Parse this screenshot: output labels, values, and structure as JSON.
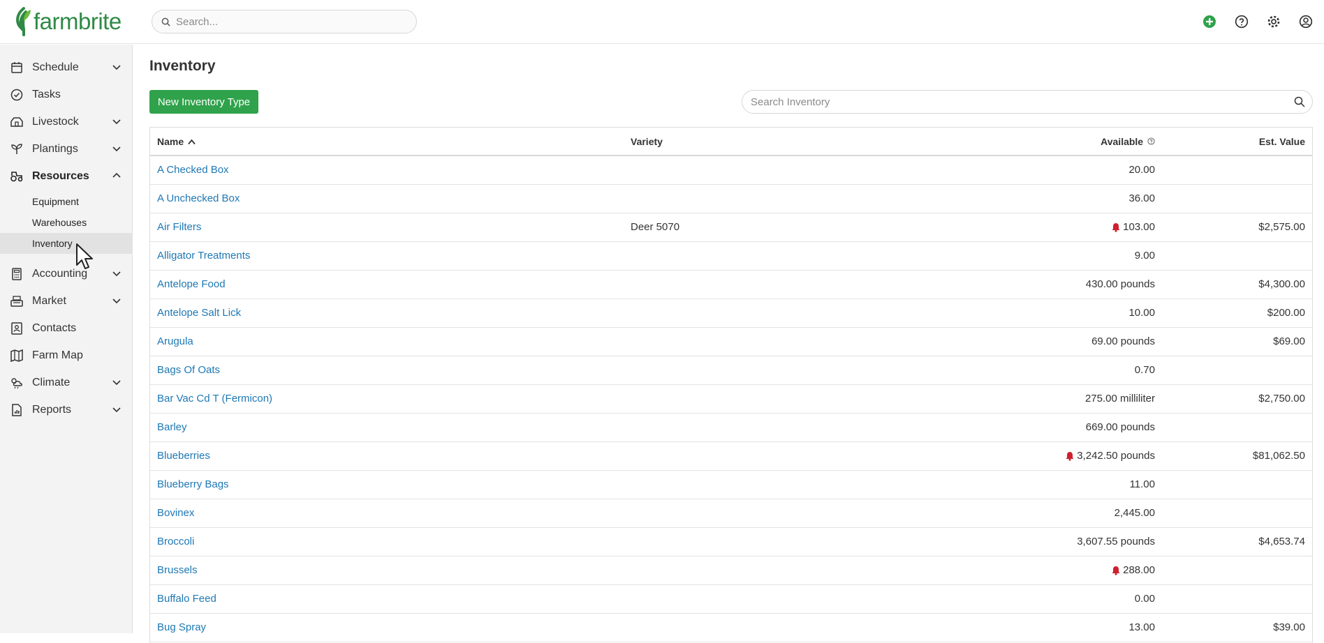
{
  "app": {
    "logo_text": "farmbrite",
    "brand_color": "#2e8a45"
  },
  "topbar": {
    "search_placeholder": "Search...",
    "icons": [
      "add-circle-icon",
      "help-icon",
      "settings-gear-icon",
      "account-user-icon"
    ]
  },
  "sidebar": {
    "items": [
      {
        "label": "Schedule",
        "icon": "calendar-icon",
        "expandable": true
      },
      {
        "label": "Tasks",
        "icon": "check-circle-icon",
        "expandable": false
      },
      {
        "label": "Livestock",
        "icon": "barn-icon",
        "expandable": true
      },
      {
        "label": "Plantings",
        "icon": "sprout-icon",
        "expandable": true
      },
      {
        "label": "Resources",
        "icon": "tractor-icon",
        "expandable": true,
        "expanded": true
      },
      {
        "label": "Accounting",
        "icon": "calculator-icon",
        "expandable": true
      },
      {
        "label": "Market",
        "icon": "register-icon",
        "expandable": true
      },
      {
        "label": "Contacts",
        "icon": "contact-card-icon",
        "expandable": false
      },
      {
        "label": "Farm Map",
        "icon": "map-icon",
        "expandable": false
      },
      {
        "label": "Climate",
        "icon": "weather-icon",
        "expandable": true
      },
      {
        "label": "Reports",
        "icon": "report-icon",
        "expandable": true
      }
    ],
    "resources_sub": [
      {
        "label": "Equipment"
      },
      {
        "label": "Warehouses"
      },
      {
        "label": "Inventory",
        "selected": true
      }
    ]
  },
  "main": {
    "title": "Inventory",
    "new_button": "New Inventory Type",
    "search_placeholder": "Search Inventory",
    "columns": {
      "name": "Name",
      "variety": "Variety",
      "available": "Available",
      "value": "Est. Value"
    },
    "rows": [
      {
        "name": "A Checked Box",
        "variety": "",
        "available": "20.00",
        "value": "",
        "alert": false
      },
      {
        "name": "A Unchecked Box",
        "variety": "",
        "available": "36.00",
        "value": "",
        "alert": false
      },
      {
        "name": "Air Filters",
        "variety": "Deer 5070",
        "available": "103.00",
        "value": "$2,575.00",
        "alert": true
      },
      {
        "name": "Alligator Treatments",
        "variety": "",
        "available": "9.00",
        "value": "",
        "alert": false
      },
      {
        "name": "Antelope Food",
        "variety": "",
        "available": "430.00 pounds",
        "value": "$4,300.00",
        "alert": false
      },
      {
        "name": "Antelope Salt Lick",
        "variety": "",
        "available": "10.00",
        "value": "$200.00",
        "alert": false
      },
      {
        "name": "Arugula",
        "variety": "",
        "available": "69.00 pounds",
        "value": "$69.00",
        "alert": false
      },
      {
        "name": "Bags Of Oats",
        "variety": "",
        "available": "0.70",
        "value": "",
        "alert": false
      },
      {
        "name": "Bar Vac Cd T (Fermicon)",
        "variety": "",
        "available": "275.00 milliliter",
        "value": "$2,750.00",
        "alert": false
      },
      {
        "name": "Barley",
        "variety": "",
        "available": "669.00 pounds",
        "value": "",
        "alert": false
      },
      {
        "name": "Blueberries",
        "variety": "",
        "available": "3,242.50 pounds",
        "value": "$81,062.50",
        "alert": true
      },
      {
        "name": "Blueberry Bags",
        "variety": "",
        "available": "11.00",
        "value": "",
        "alert": false
      },
      {
        "name": "Bovinex",
        "variety": "",
        "available": "2,445.00",
        "value": "",
        "alert": false
      },
      {
        "name": "Broccoli",
        "variety": "",
        "available": "3,607.55 pounds",
        "value": "$4,653.74",
        "alert": false
      },
      {
        "name": "Brussels",
        "variety": "",
        "available": "288.00",
        "value": "",
        "alert": true
      },
      {
        "name": "Buffalo Feed",
        "variety": "",
        "available": "0.00",
        "value": "",
        "alert": false
      },
      {
        "name": "Bug Spray",
        "variety": "",
        "available": "13.00",
        "value": "$39.00",
        "alert": false
      }
    ],
    "colors": {
      "link": "#1e78b4",
      "button": "#2fa24b",
      "alert": "#d0202e"
    }
  }
}
